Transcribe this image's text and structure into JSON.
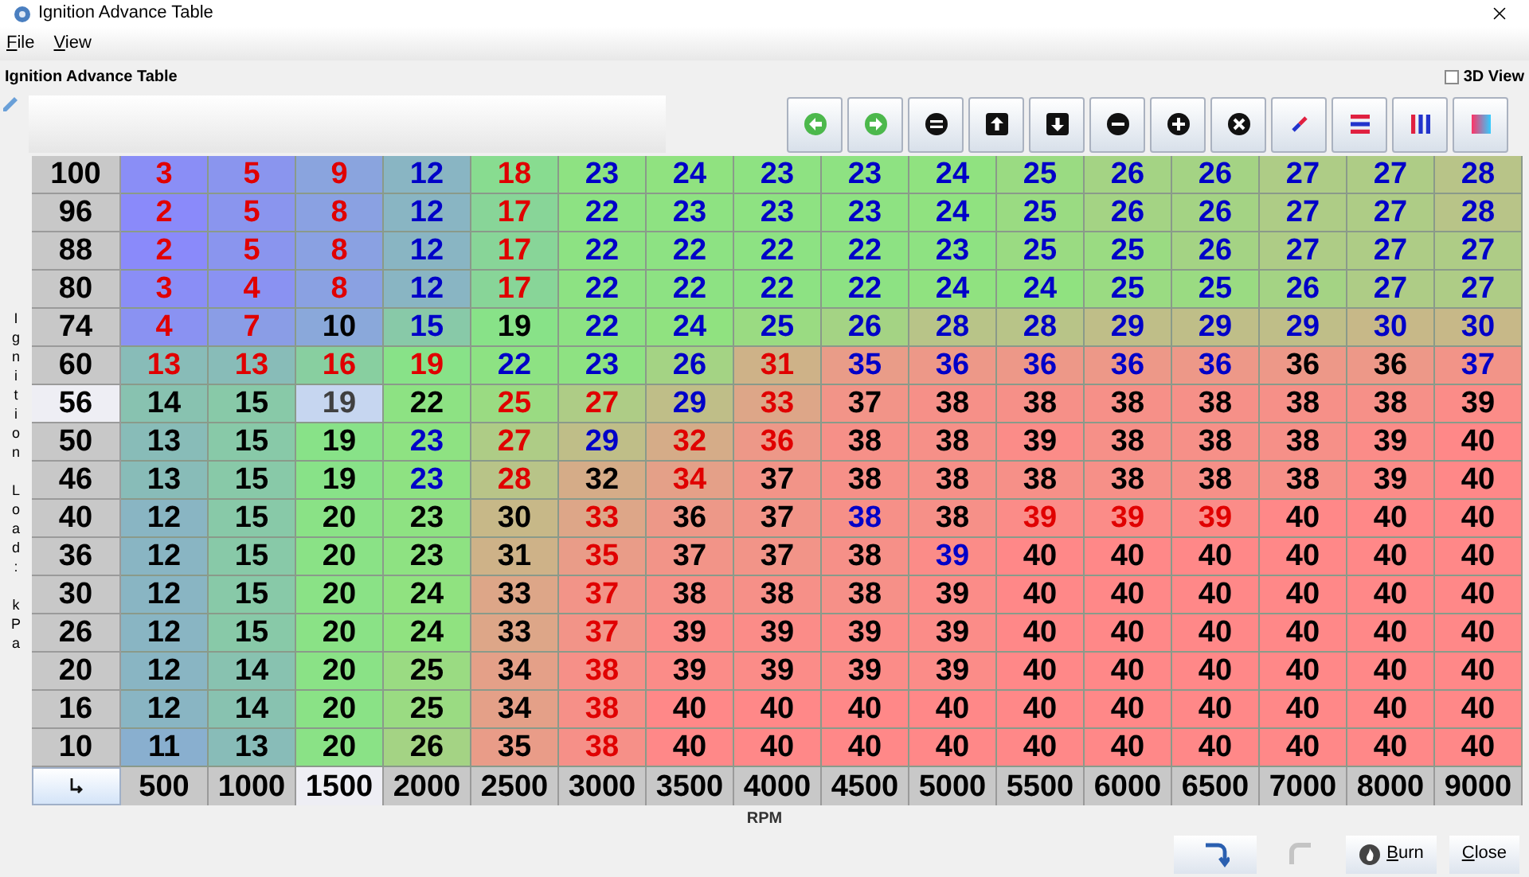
{
  "window": {
    "title": "Ignition Advance Table"
  },
  "menu": [
    {
      "label": "File"
    },
    {
      "label": "View"
    }
  ],
  "panel_title": "Ignition Advance Table",
  "view_3d": {
    "label": "3D View",
    "checked": false
  },
  "y_axis_label": "Ignition Load: kPa",
  "x_axis_label": "RPM",
  "columns": [
    {
      "label": "500",
      "selected": false
    },
    {
      "label": "1000",
      "selected": false
    },
    {
      "label": "1500",
      "selected": true
    },
    {
      "label": "2000",
      "selected": false
    },
    {
      "label": "2500",
      "selected": false
    },
    {
      "label": "3000",
      "selected": false
    },
    {
      "label": "3500",
      "selected": false
    },
    {
      "label": "4000",
      "selected": false
    },
    {
      "label": "4500",
      "selected": false
    },
    {
      "label": "5000",
      "selected": false
    },
    {
      "label": "5500",
      "selected": false
    },
    {
      "label": "6000",
      "selected": false
    },
    {
      "label": "6500",
      "selected": false
    },
    {
      "label": "7000",
      "selected": false
    },
    {
      "label": "8000",
      "selected": false
    },
    {
      "label": "9000",
      "selected": false
    }
  ],
  "rows": [
    {
      "label": "100",
      "selected": false,
      "cells": [
        {
          "value": "3",
          "color": "#e00000"
        },
        {
          "value": "5",
          "color": "#e00000"
        },
        {
          "value": "9",
          "color": "#e00000"
        },
        {
          "value": "12",
          "color": "#0000c8"
        },
        {
          "value": "18",
          "color": "#e00000"
        },
        {
          "value": "23",
          "color": "#0000c8"
        },
        {
          "value": "24",
          "color": "#0000c8"
        },
        {
          "value": "23",
          "color": "#0000c8"
        },
        {
          "value": "23",
          "color": "#0000c8"
        },
        {
          "value": "24",
          "color": "#0000c8"
        },
        {
          "value": "25",
          "color": "#0000c8"
        },
        {
          "value": "26",
          "color": "#0000c8"
        },
        {
          "value": "26",
          "color": "#0000c8"
        },
        {
          "value": "27",
          "color": "#0000c8"
        },
        {
          "value": "27",
          "color": "#0000c8"
        },
        {
          "value": "28",
          "color": "#0000c8"
        }
      ]
    },
    {
      "label": "96",
      "selected": false,
      "cells": [
        {
          "value": "2",
          "color": "#e00000"
        },
        {
          "value": "5",
          "color": "#e00000"
        },
        {
          "value": "8",
          "color": "#e00000"
        },
        {
          "value": "12",
          "color": "#0000c8"
        },
        {
          "value": "17",
          "color": "#e00000"
        },
        {
          "value": "22",
          "color": "#0000c8"
        },
        {
          "value": "23",
          "color": "#0000c8"
        },
        {
          "value": "23",
          "color": "#0000c8"
        },
        {
          "value": "23",
          "color": "#0000c8"
        },
        {
          "value": "24",
          "color": "#0000c8"
        },
        {
          "value": "25",
          "color": "#0000c8"
        },
        {
          "value": "26",
          "color": "#0000c8"
        },
        {
          "value": "26",
          "color": "#0000c8"
        },
        {
          "value": "27",
          "color": "#0000c8"
        },
        {
          "value": "27",
          "color": "#0000c8"
        },
        {
          "value": "28",
          "color": "#0000c8"
        }
      ]
    },
    {
      "label": "88",
      "selected": false,
      "cells": [
        {
          "value": "2",
          "color": "#e00000"
        },
        {
          "value": "5",
          "color": "#e00000"
        },
        {
          "value": "8",
          "color": "#e00000"
        },
        {
          "value": "12",
          "color": "#0000c8"
        },
        {
          "value": "17",
          "color": "#e00000"
        },
        {
          "value": "22",
          "color": "#0000c8"
        },
        {
          "value": "22",
          "color": "#0000c8"
        },
        {
          "value": "22",
          "color": "#0000c8"
        },
        {
          "value": "22",
          "color": "#0000c8"
        },
        {
          "value": "23",
          "color": "#0000c8"
        },
        {
          "value": "25",
          "color": "#0000c8"
        },
        {
          "value": "25",
          "color": "#0000c8"
        },
        {
          "value": "26",
          "color": "#0000c8"
        },
        {
          "value": "27",
          "color": "#0000c8"
        },
        {
          "value": "27",
          "color": "#0000c8"
        },
        {
          "value": "27",
          "color": "#0000c8"
        }
      ]
    },
    {
      "label": "80",
      "selected": false,
      "cells": [
        {
          "value": "3",
          "color": "#e00000"
        },
        {
          "value": "4",
          "color": "#e00000"
        },
        {
          "value": "8",
          "color": "#e00000"
        },
        {
          "value": "12",
          "color": "#0000c8"
        },
        {
          "value": "17",
          "color": "#e00000"
        },
        {
          "value": "22",
          "color": "#0000c8"
        },
        {
          "value": "22",
          "color": "#0000c8"
        },
        {
          "value": "22",
          "color": "#0000c8"
        },
        {
          "value": "22",
          "color": "#0000c8"
        },
        {
          "value": "24",
          "color": "#0000c8"
        },
        {
          "value": "24",
          "color": "#0000c8"
        },
        {
          "value": "25",
          "color": "#0000c8"
        },
        {
          "value": "25",
          "color": "#0000c8"
        },
        {
          "value": "26",
          "color": "#0000c8"
        },
        {
          "value": "27",
          "color": "#0000c8"
        },
        {
          "value": "27",
          "color": "#0000c8"
        }
      ]
    },
    {
      "label": "74",
      "selected": false,
      "cells": [
        {
          "value": "4",
          "color": "#e00000"
        },
        {
          "value": "7",
          "color": "#e00000"
        },
        {
          "value": "10",
          "color": "#000000"
        },
        {
          "value": "15",
          "color": "#0000c8"
        },
        {
          "value": "19",
          "color": "#000000"
        },
        {
          "value": "22",
          "color": "#0000c8"
        },
        {
          "value": "24",
          "color": "#0000c8"
        },
        {
          "value": "25",
          "color": "#0000c8"
        },
        {
          "value": "26",
          "color": "#0000c8"
        },
        {
          "value": "28",
          "color": "#0000c8"
        },
        {
          "value": "28",
          "color": "#0000c8"
        },
        {
          "value": "29",
          "color": "#0000c8"
        },
        {
          "value": "29",
          "color": "#0000c8"
        },
        {
          "value": "29",
          "color": "#0000c8"
        },
        {
          "value": "30",
          "color": "#0000c8"
        },
        {
          "value": "30",
          "color": "#0000c8"
        }
      ]
    },
    {
      "label": "60",
      "selected": false,
      "cells": [
        {
          "value": "13",
          "color": "#e00000"
        },
        {
          "value": "13",
          "color": "#e00000"
        },
        {
          "value": "16",
          "color": "#e00000"
        },
        {
          "value": "19",
          "color": "#e00000"
        },
        {
          "value": "22",
          "color": "#0000c8"
        },
        {
          "value": "23",
          "color": "#0000c8"
        },
        {
          "value": "26",
          "color": "#0000c8"
        },
        {
          "value": "31",
          "color": "#e00000"
        },
        {
          "value": "35",
          "color": "#0000c8"
        },
        {
          "value": "36",
          "color": "#0000c8"
        },
        {
          "value": "36",
          "color": "#0000c8"
        },
        {
          "value": "36",
          "color": "#0000c8"
        },
        {
          "value": "36",
          "color": "#0000c8"
        },
        {
          "value": "36",
          "color": "#000000"
        },
        {
          "value": "36",
          "color": "#000000"
        },
        {
          "value": "37",
          "color": "#0000c8"
        }
      ]
    },
    {
      "label": "56",
      "selected": true,
      "cells": [
        {
          "value": "14",
          "color": "#000000"
        },
        {
          "value": "15",
          "color": "#000000"
        },
        {
          "value": "19",
          "color": "#404040"
        },
        {
          "value": "22",
          "color": "#000000"
        },
        {
          "value": "25",
          "color": "#e00000"
        },
        {
          "value": "27",
          "color": "#e00000"
        },
        {
          "value": "29",
          "color": "#0000c8"
        },
        {
          "value": "33",
          "color": "#e00000"
        },
        {
          "value": "37",
          "color": "#000000"
        },
        {
          "value": "38",
          "color": "#000000"
        },
        {
          "value": "38",
          "color": "#000000"
        },
        {
          "value": "38",
          "color": "#000000"
        },
        {
          "value": "38",
          "color": "#000000"
        },
        {
          "value": "38",
          "color": "#000000"
        },
        {
          "value": "38",
          "color": "#000000"
        },
        {
          "value": "39",
          "color": "#000000"
        }
      ]
    },
    {
      "label": "50",
      "selected": false,
      "cells": [
        {
          "value": "13",
          "color": "#000000"
        },
        {
          "value": "15",
          "color": "#000000"
        },
        {
          "value": "19",
          "color": "#000000"
        },
        {
          "value": "23",
          "color": "#0000c8"
        },
        {
          "value": "27",
          "color": "#e00000"
        },
        {
          "value": "29",
          "color": "#0000c8"
        },
        {
          "value": "32",
          "color": "#e00000"
        },
        {
          "value": "36",
          "color": "#e00000"
        },
        {
          "value": "38",
          "color": "#000000"
        },
        {
          "value": "38",
          "color": "#000000"
        },
        {
          "value": "39",
          "color": "#000000"
        },
        {
          "value": "38",
          "color": "#000000"
        },
        {
          "value": "38",
          "color": "#000000"
        },
        {
          "value": "38",
          "color": "#000000"
        },
        {
          "value": "39",
          "color": "#000000"
        },
        {
          "value": "40",
          "color": "#000000"
        }
      ]
    },
    {
      "label": "46",
      "selected": false,
      "cells": [
        {
          "value": "13",
          "color": "#000000"
        },
        {
          "value": "15",
          "color": "#000000"
        },
        {
          "value": "19",
          "color": "#000000"
        },
        {
          "value": "23",
          "color": "#0000c8"
        },
        {
          "value": "28",
          "color": "#e00000"
        },
        {
          "value": "32",
          "color": "#000000"
        },
        {
          "value": "34",
          "color": "#e00000"
        },
        {
          "value": "37",
          "color": "#000000"
        },
        {
          "value": "38",
          "color": "#000000"
        },
        {
          "value": "38",
          "color": "#000000"
        },
        {
          "value": "38",
          "color": "#000000"
        },
        {
          "value": "38",
          "color": "#000000"
        },
        {
          "value": "38",
          "color": "#000000"
        },
        {
          "value": "38",
          "color": "#000000"
        },
        {
          "value": "39",
          "color": "#000000"
        },
        {
          "value": "40",
          "color": "#000000"
        }
      ]
    },
    {
      "label": "40",
      "selected": false,
      "cells": [
        {
          "value": "12",
          "color": "#000000"
        },
        {
          "value": "15",
          "color": "#000000"
        },
        {
          "value": "20",
          "color": "#000000"
        },
        {
          "value": "23",
          "color": "#000000"
        },
        {
          "value": "30",
          "color": "#000000"
        },
        {
          "value": "33",
          "color": "#e00000"
        },
        {
          "value": "36",
          "color": "#000000"
        },
        {
          "value": "37",
          "color": "#000000"
        },
        {
          "value": "38",
          "color": "#0000c8"
        },
        {
          "value": "38",
          "color": "#000000"
        },
        {
          "value": "39",
          "color": "#e00000"
        },
        {
          "value": "39",
          "color": "#e00000"
        },
        {
          "value": "39",
          "color": "#e00000"
        },
        {
          "value": "40",
          "color": "#000000"
        },
        {
          "value": "40",
          "color": "#000000"
        },
        {
          "value": "40",
          "color": "#000000"
        }
      ]
    },
    {
      "label": "36",
      "selected": false,
      "cells": [
        {
          "value": "12",
          "color": "#000000"
        },
        {
          "value": "15",
          "color": "#000000"
        },
        {
          "value": "20",
          "color": "#000000"
        },
        {
          "value": "23",
          "color": "#000000"
        },
        {
          "value": "31",
          "color": "#000000"
        },
        {
          "value": "35",
          "color": "#e00000"
        },
        {
          "value": "37",
          "color": "#000000"
        },
        {
          "value": "37",
          "color": "#000000"
        },
        {
          "value": "38",
          "color": "#000000"
        },
        {
          "value": "39",
          "color": "#0000c8"
        },
        {
          "value": "40",
          "color": "#000000"
        },
        {
          "value": "40",
          "color": "#000000"
        },
        {
          "value": "40",
          "color": "#000000"
        },
        {
          "value": "40",
          "color": "#000000"
        },
        {
          "value": "40",
          "color": "#000000"
        },
        {
          "value": "40",
          "color": "#000000"
        }
      ]
    },
    {
      "label": "30",
      "selected": false,
      "cells": [
        {
          "value": "12",
          "color": "#000000"
        },
        {
          "value": "15",
          "color": "#000000"
        },
        {
          "value": "20",
          "color": "#000000"
        },
        {
          "value": "24",
          "color": "#000000"
        },
        {
          "value": "33",
          "color": "#000000"
        },
        {
          "value": "37",
          "color": "#e00000"
        },
        {
          "value": "38",
          "color": "#000000"
        },
        {
          "value": "38",
          "color": "#000000"
        },
        {
          "value": "38",
          "color": "#000000"
        },
        {
          "value": "39",
          "color": "#000000"
        },
        {
          "value": "40",
          "color": "#000000"
        },
        {
          "value": "40",
          "color": "#000000"
        },
        {
          "value": "40",
          "color": "#000000"
        },
        {
          "value": "40",
          "color": "#000000"
        },
        {
          "value": "40",
          "color": "#000000"
        },
        {
          "value": "40",
          "color": "#000000"
        }
      ]
    },
    {
      "label": "26",
      "selected": false,
      "cells": [
        {
          "value": "12",
          "color": "#000000"
        },
        {
          "value": "15",
          "color": "#000000"
        },
        {
          "value": "20",
          "color": "#000000"
        },
        {
          "value": "24",
          "color": "#000000"
        },
        {
          "value": "33",
          "color": "#000000"
        },
        {
          "value": "37",
          "color": "#e00000"
        },
        {
          "value": "39",
          "color": "#000000"
        },
        {
          "value": "39",
          "color": "#000000"
        },
        {
          "value": "39",
          "color": "#000000"
        },
        {
          "value": "39",
          "color": "#000000"
        },
        {
          "value": "40",
          "color": "#000000"
        },
        {
          "value": "40",
          "color": "#000000"
        },
        {
          "value": "40",
          "color": "#000000"
        },
        {
          "value": "40",
          "color": "#000000"
        },
        {
          "value": "40",
          "color": "#000000"
        },
        {
          "value": "40",
          "color": "#000000"
        }
      ]
    },
    {
      "label": "20",
      "selected": false,
      "cells": [
        {
          "value": "12",
          "color": "#000000"
        },
        {
          "value": "14",
          "color": "#000000"
        },
        {
          "value": "20",
          "color": "#000000"
        },
        {
          "value": "25",
          "color": "#000000"
        },
        {
          "value": "34",
          "color": "#000000"
        },
        {
          "value": "38",
          "color": "#e00000"
        },
        {
          "value": "39",
          "color": "#000000"
        },
        {
          "value": "39",
          "color": "#000000"
        },
        {
          "value": "39",
          "color": "#000000"
        },
        {
          "value": "39",
          "color": "#000000"
        },
        {
          "value": "40",
          "color": "#000000"
        },
        {
          "value": "40",
          "color": "#000000"
        },
        {
          "value": "40",
          "color": "#000000"
        },
        {
          "value": "40",
          "color": "#000000"
        },
        {
          "value": "40",
          "color": "#000000"
        },
        {
          "value": "40",
          "color": "#000000"
        }
      ]
    },
    {
      "label": "16",
      "selected": false,
      "cells": [
        {
          "value": "12",
          "color": "#000000"
        },
        {
          "value": "14",
          "color": "#000000"
        },
        {
          "value": "20",
          "color": "#000000"
        },
        {
          "value": "25",
          "color": "#000000"
        },
        {
          "value": "34",
          "color": "#000000"
        },
        {
          "value": "38",
          "color": "#e00000"
        },
        {
          "value": "40",
          "color": "#000000"
        },
        {
          "value": "40",
          "color": "#000000"
        },
        {
          "value": "40",
          "color": "#000000"
        },
        {
          "value": "40",
          "color": "#000000"
        },
        {
          "value": "40",
          "color": "#000000"
        },
        {
          "value": "40",
          "color": "#000000"
        },
        {
          "value": "40",
          "color": "#000000"
        },
        {
          "value": "40",
          "color": "#000000"
        },
        {
          "value": "40",
          "color": "#000000"
        },
        {
          "value": "40",
          "color": "#000000"
        }
      ]
    },
    {
      "label": "10",
      "selected": false,
      "cells": [
        {
          "value": "11",
          "color": "#000000"
        },
        {
          "value": "13",
          "color": "#000000"
        },
        {
          "value": "20",
          "color": "#000000"
        },
        {
          "value": "26",
          "color": "#000000"
        },
        {
          "value": "35",
          "color": "#000000"
        },
        {
          "value": "38",
          "color": "#e00000"
        },
        {
          "value": "40",
          "color": "#000000"
        },
        {
          "value": "40",
          "color": "#000000"
        },
        {
          "value": "40",
          "color": "#000000"
        },
        {
          "value": "40",
          "color": "#000000"
        },
        {
          "value": "40",
          "color": "#000000"
        },
        {
          "value": "40",
          "color": "#000000"
        },
        {
          "value": "40",
          "color": "#000000"
        },
        {
          "value": "40",
          "color": "#000000"
        },
        {
          "value": "40",
          "color": "#000000"
        },
        {
          "value": "40",
          "color": "#000000"
        }
      ]
    }
  ],
  "undo": {
    "disabled": false
  },
  "redo": {
    "disabled": true
  },
  "buttons": [
    {
      "kind": "burn",
      "label": "Burn"
    },
    {
      "kind": "close",
      "label": "Close"
    }
  ]
}
